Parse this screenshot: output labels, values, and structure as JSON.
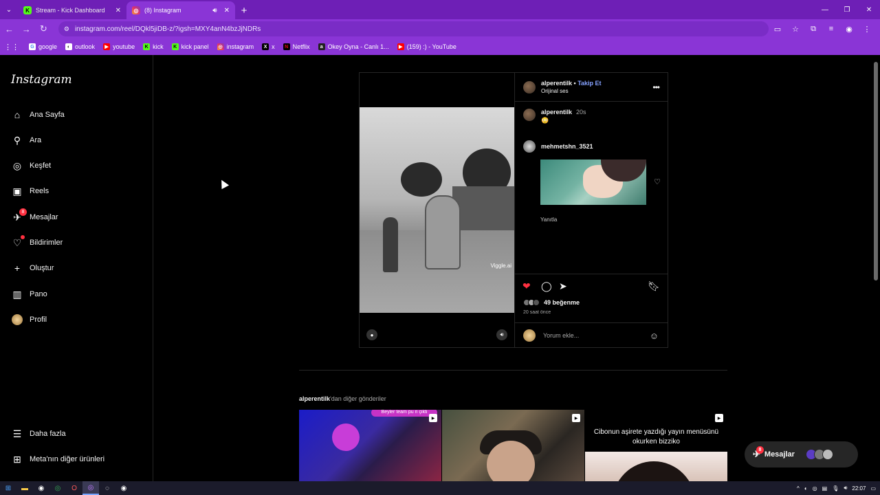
{
  "browser": {
    "tabs": [
      {
        "title": "Stream - Kick Dashboard",
        "favicon": "kick-icon",
        "active": false
      },
      {
        "title": "(8) Instagram",
        "favicon": "instagram-icon",
        "active": true
      }
    ],
    "url": "instagram.com/reel/DQkl5jiDB-z/?igsh=MXY4anN4bzJjNDRs",
    "bookmarks": [
      "google",
      "outlook",
      "youtube",
      "kick",
      "kick panel",
      "instagram",
      "x",
      "Netflix",
      "Okey Oyna - Canlı 1...",
      "(159) :) - YouTube"
    ]
  },
  "sidebar": {
    "logo": "Instagram",
    "items": [
      {
        "label": "Ana Sayfa",
        "icon": "home-icon"
      },
      {
        "label": "Ara",
        "icon": "search-icon"
      },
      {
        "label": "Keşfet",
        "icon": "compass-icon"
      },
      {
        "label": "Reels",
        "icon": "reels-icon"
      },
      {
        "label": "Mesajlar",
        "icon": "messenger-icon",
        "badge": "8"
      },
      {
        "label": "Bildirimler",
        "icon": "heart-icon"
      },
      {
        "label": "Oluştur",
        "icon": "plus-icon"
      },
      {
        "label": "Pano",
        "icon": "dashboard-icon"
      },
      {
        "label": "Profil",
        "icon": "avatar"
      }
    ],
    "bottom": [
      {
        "label": "Daha fazla",
        "icon": "menu-icon"
      },
      {
        "label": "Meta'nın diğer ürünleri",
        "icon": "apps-icon"
      }
    ]
  },
  "post": {
    "username": "alperentilk",
    "separator": "•",
    "follow": "Takip Et",
    "audio": "Orijinal ses",
    "watermark": "Viggle.ai",
    "caption_user": "alperentilk",
    "caption_time": "20s",
    "caption_emoji": "😳",
    "comment_user": "mehmetshn_3521",
    "reply_label": "Yanıtla",
    "likes": "49 beğenme",
    "time_ago": "20 saat önce",
    "comment_placeholder": "Yorum ekle..."
  },
  "more_posts": {
    "user": "alperentilk",
    "suffix": "'dan diğer gönderiler",
    "thumb1_text": "Beyler team pu ri çikti",
    "thumb3_caption": "Cibonun aşirete yazdığı yayın menüsünü okurken bizziko"
  },
  "floating_messages": {
    "label": "Mesajlar",
    "badge": "8"
  },
  "taskbar": {
    "time": "22:07"
  },
  "colors": {
    "accent": "#8a35d6",
    "follow": "#85a1ff",
    "badge": "#ff3040",
    "like": "#ff3040"
  }
}
